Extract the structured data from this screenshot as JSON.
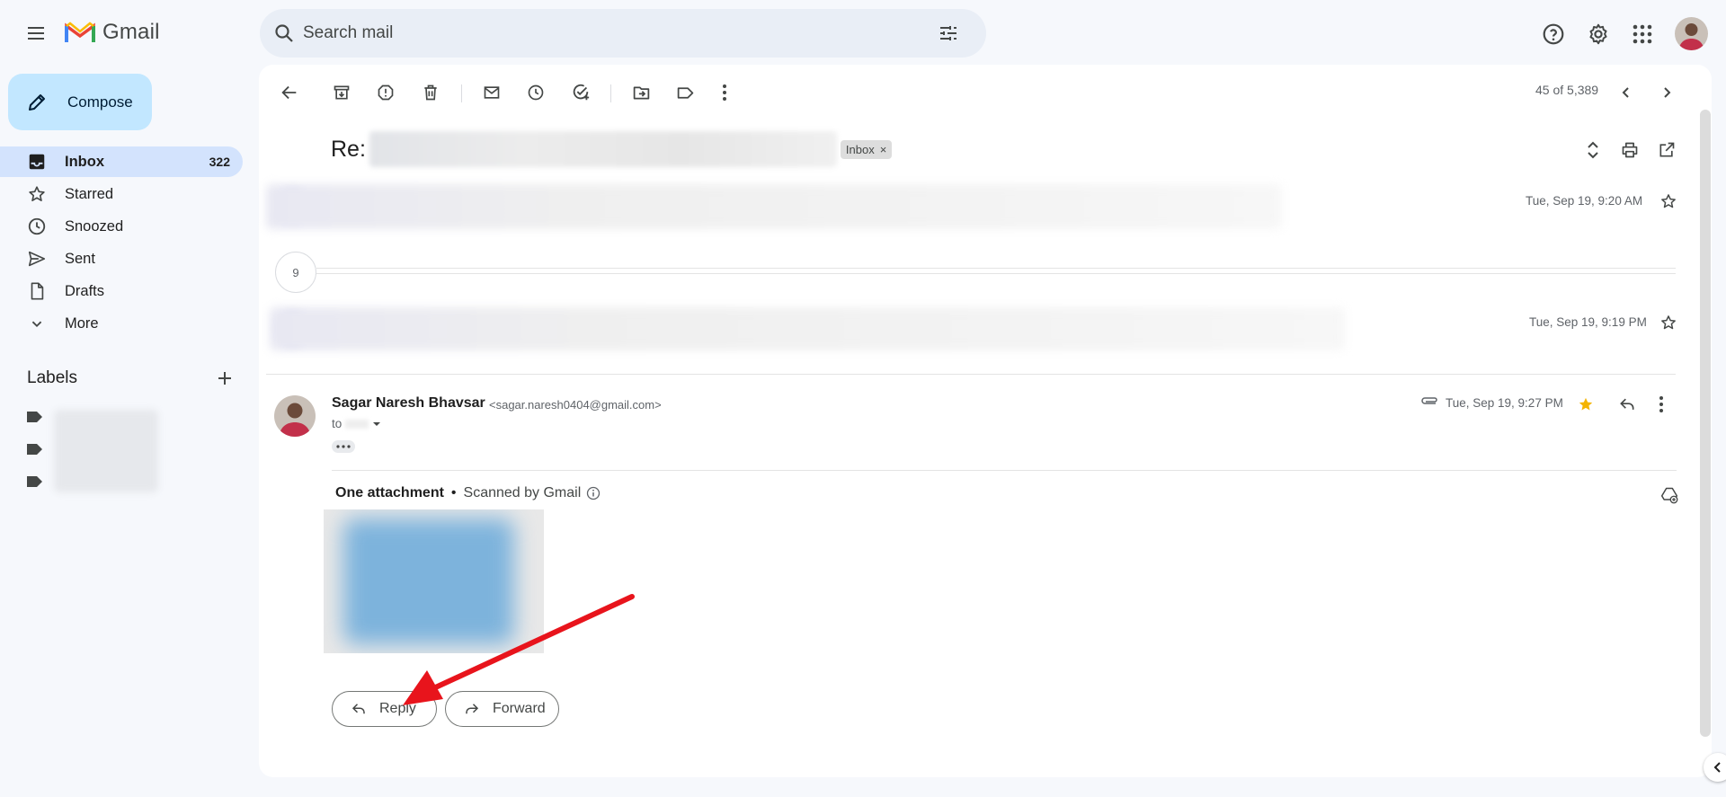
{
  "app": {
    "name": "Gmail"
  },
  "search": {
    "placeholder": "Search mail"
  },
  "sidebar": {
    "compose_label": "Compose",
    "items": [
      {
        "label": "Inbox",
        "count": "322",
        "icon": "inbox-icon",
        "active": true
      },
      {
        "label": "Starred",
        "icon": "star-icon"
      },
      {
        "label": "Snoozed",
        "icon": "clock-icon"
      },
      {
        "label": "Sent",
        "icon": "send-icon"
      },
      {
        "label": "Drafts",
        "icon": "draft-icon"
      },
      {
        "label": "More",
        "icon": "chevron-down-icon"
      }
    ],
    "labels_heading": "Labels"
  },
  "toolbar": {
    "page_count": "45 of 5,389"
  },
  "thread": {
    "subject_prefix": "Re:",
    "inbox_chip": "Inbox",
    "inbox_chip_close": "×",
    "collapsed_count": "9",
    "messages": [
      {
        "date": "Tue, Sep 19, 9:20 AM"
      },
      {
        "date": "Tue, Sep 19, 9:19 PM"
      }
    ],
    "open_message": {
      "sender_name": "Sagar Naresh Bhavsar",
      "sender_email": "<sagar.naresh0404@gmail.com>",
      "to_label": "to",
      "date": "Tue, Sep 19, 9:27 PM",
      "starred": true,
      "attachment_title": "One attachment",
      "attachment_dot": "•",
      "attachment_scanned": "Scanned by Gmail"
    },
    "reply_label": "Reply",
    "forward_label": "Forward"
  },
  "colors": {
    "accent": "#c2e7ff",
    "active_nav": "#d3e3fd",
    "star": "#f4b400",
    "annotation_arrow": "#e8141c"
  }
}
